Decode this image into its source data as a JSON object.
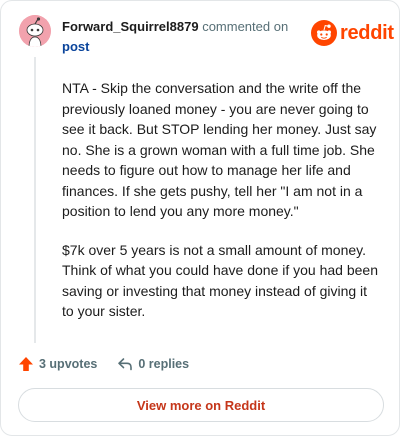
{
  "comment": {
    "username": "Forward_Squirrel8879",
    "action_text": "commented on",
    "post_link": "post",
    "paragraphs": [
      "NTA - Skip the conversation and the write off the previously loaned money - you are never going to see it back. But STOP lending her money. Just say no. She is a grown woman with a full time job. She needs to figure out how to manage her life and finances. If she gets pushy, tell her \"I am not in a position to lend you any more money.\"",
      "$7k over 5 years is not a small amount of money. Think of what you could have done if you had been saving or investing that money instead of giving it to your sister."
    ],
    "upvotes_label": "3 upvotes",
    "replies_label": "0 replies"
  },
  "brand": {
    "name": "reddit",
    "color": "#ff4500"
  },
  "footer": {
    "view_more_label": "View more on Reddit"
  },
  "icons": {
    "avatar": "snoo-avatar-icon",
    "logo": "reddit-logo-icon",
    "upvote": "upvote-arrow-icon",
    "reply": "reply-arrow-icon"
  },
  "colors": {
    "accent": "#ff4500",
    "link": "#0a449b",
    "muted": "#576f76",
    "avatar_bg": "#f2a2ad"
  }
}
